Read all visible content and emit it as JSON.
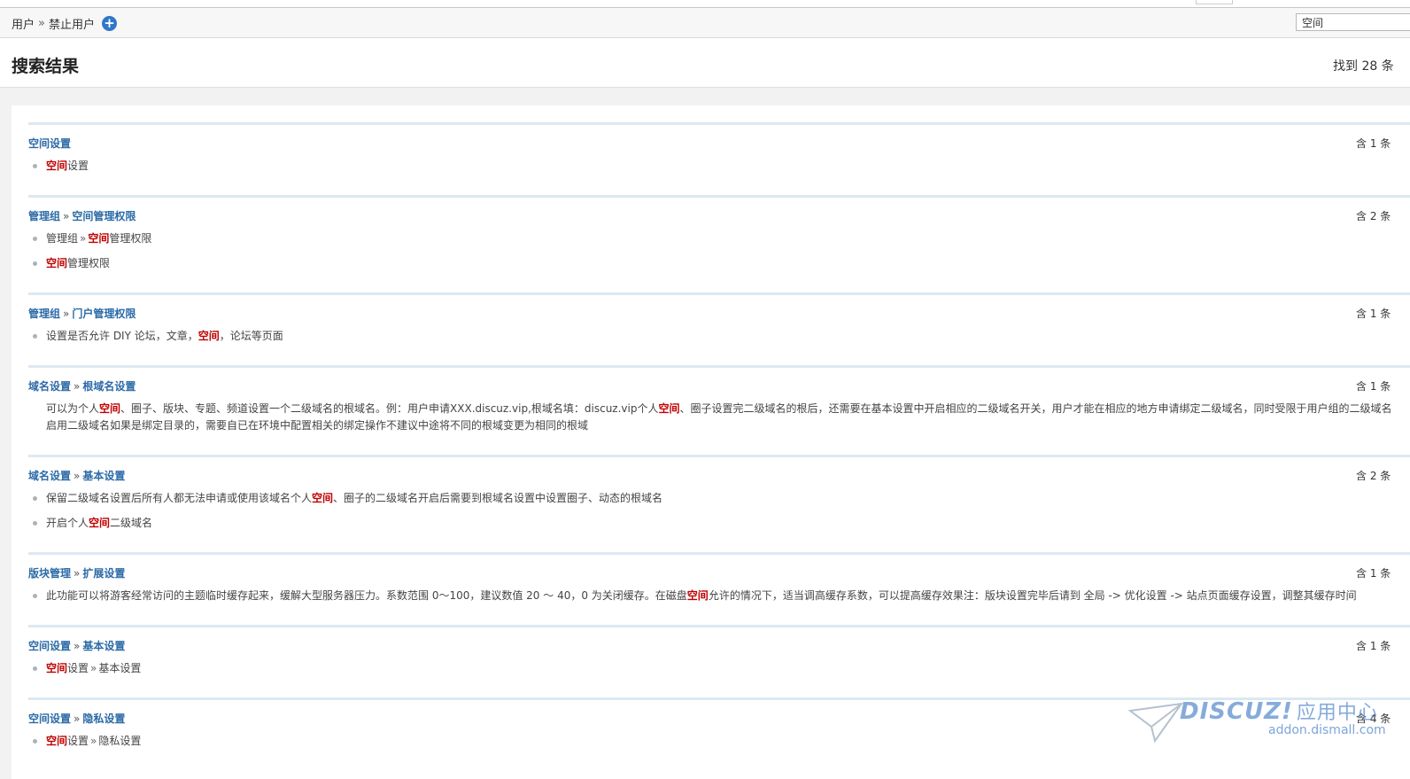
{
  "breadcrumb": {
    "part1": "用户",
    "sep": "»",
    "part2": "禁止用户",
    "add_glyph": "+"
  },
  "search": {
    "value": "空间"
  },
  "header": {
    "title": "搜索结果",
    "found": "找到 28 条"
  },
  "colors": {
    "link": "#2b6aa7",
    "highlight": "#c00000",
    "accent": "#2f77c9"
  },
  "groups": [
    {
      "head1": "空间设置",
      "count": "含 1 条",
      "items": [
        {
          "hl": "空间",
          "rest": "设置"
        }
      ]
    },
    {
      "head1": "管理组",
      "head2": "空间管理权限",
      "count": "含 2 条",
      "items": [
        {
          "pre": "管理组",
          "sep": "»",
          "hl": "空间",
          "rest": "管理权限"
        },
        {
          "hl": "空间",
          "rest": "管理权限"
        }
      ]
    },
    {
      "head1": "管理组",
      "head2": "门户管理权限",
      "count": "含 1 条",
      "items": [
        {
          "pre": "设置是否允许 DIY 论坛，文章，",
          "hl": "空间",
          "rest": "，论坛等页面"
        }
      ]
    },
    {
      "head1": "域名设置",
      "head2": "根域名设置",
      "count": "含 1 条",
      "items": [
        {
          "pre": "可以为个人",
          "hl": "空间",
          "mid": "、圈子、版块、专题、频道设置一个二级域名的根域名。例：用户申请XXX.discuz.vip,根域名填：discuz.vip个人",
          "hl2": "空间",
          "rest": "、圈子设置完二级域名的根后，还需要在基本设置中开启相应的二级域名开关，用户才能在相应的地方申请绑定二级域名，同时受限于用户组的二级域名长度",
          "line2": "启用二级域名如果是绑定目录的，需要自已在环境中配置相关的绑定操作不建议中途将不同的根域变更为相同的根域"
        }
      ]
    },
    {
      "head1": "域名设置",
      "head2": "基本设置",
      "count": "含 2 条",
      "items": [
        {
          "pre": "保留二级域名设置后所有人都无法申请或使用该域名个人",
          "hl": "空间",
          "rest": "、圈子的二级域名开启后需要到根域名设置中设置圈子、动态的根域名"
        },
        {
          "pre": "开启个人",
          "hl": "空间",
          "rest": "二级域名"
        }
      ]
    },
    {
      "head1": "版块管理",
      "head2": "扩展设置",
      "count": "含 1 条",
      "items": [
        {
          "pre": "此功能可以将游客经常访问的主题临时缓存起来，缓解大型服务器压力。系数范围 0～100，建议数值 20 ～ 40，0 为关闭缓存。在磁盘",
          "hl": "空间",
          "rest": "允许的情况下，适当调高缓存系数，可以提高缓存效果注：版块设置完毕后请到 全局 -> 优化设置 -> 站点页面缓存设置，调整其缓存时间"
        }
      ]
    },
    {
      "head1": "空间设置",
      "head2": "基本设置",
      "count": "含 1 条",
      "items": [
        {
          "hl": "空间",
          "rest": "设置",
          "sep": "»",
          "tail": "基本设置"
        }
      ]
    },
    {
      "head1": "空间设置",
      "head2": "隐私设置",
      "count": "含 4 条",
      "items": [
        {
          "hl": "空间",
          "rest": "设置",
          "sep": "»",
          "tail": "隐私设置"
        }
      ]
    }
  ],
  "watermark": {
    "brand": "DISCUZ!",
    "cn": "应用中心",
    "url": "addon.dismall.com"
  }
}
